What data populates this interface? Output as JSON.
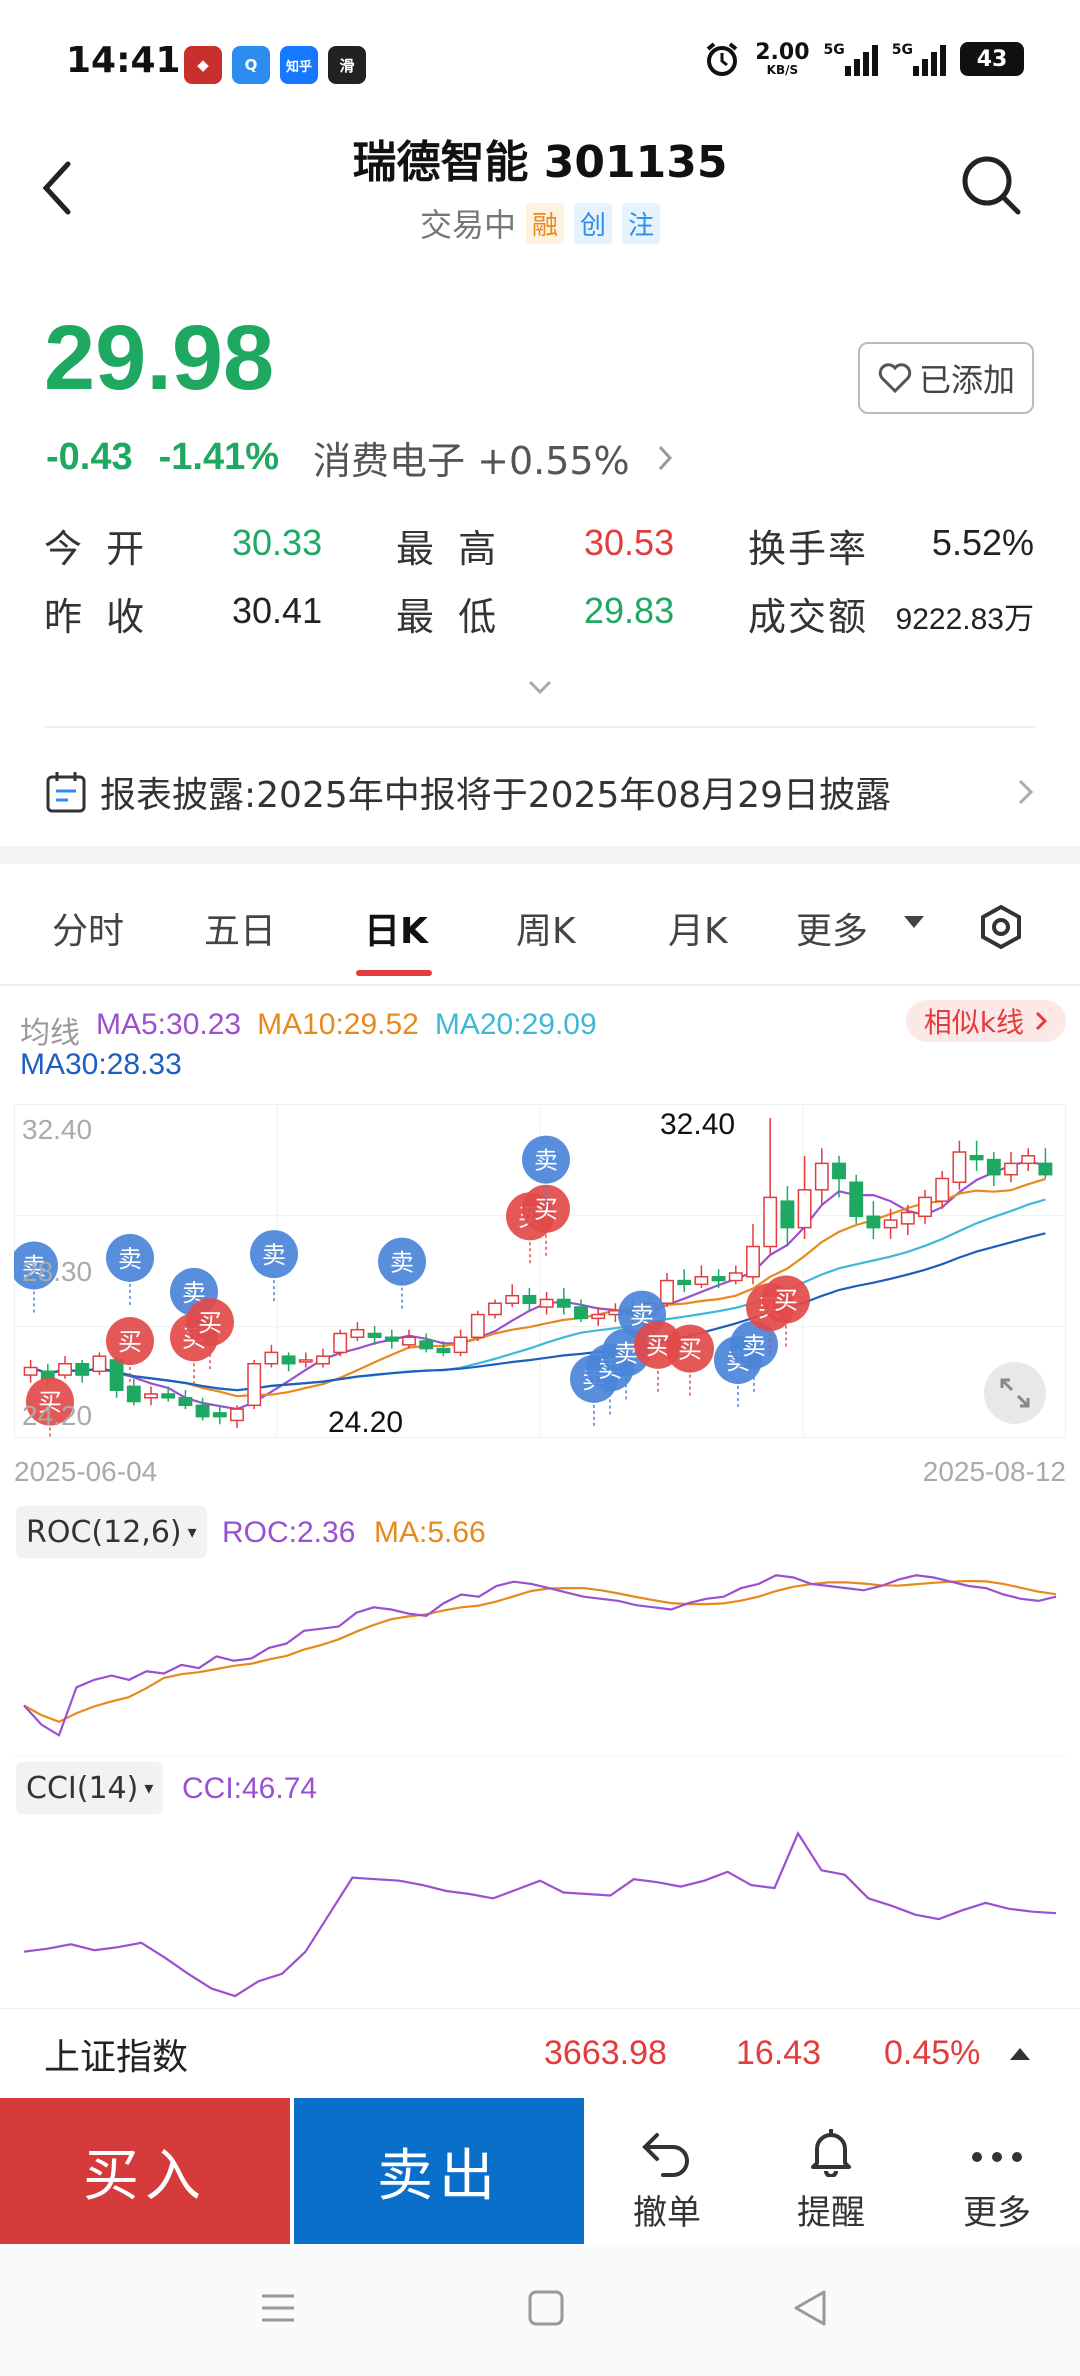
{
  "status_bar": {
    "time": "14:41",
    "apps": [
      {
        "name": "app-icon-1",
        "label": "◆",
        "color": "#c9302c"
      },
      {
        "name": "app-icon-2",
        "label": "Q",
        "color": "#2d8cf0"
      },
      {
        "name": "app-icon-3",
        "label": "知乎",
        "color": "#1677ff"
      },
      {
        "name": "app-icon-4",
        "label": "滑",
        "color": "#222222"
      }
    ],
    "net_speed": "2.00",
    "net_unit": "KB/S",
    "signal1": "5G",
    "signal2": "5G",
    "battery": "43"
  },
  "header": {
    "title": "瑞德智能 301135",
    "trade_status": "交易中",
    "tags": [
      "融",
      "创",
      "注"
    ]
  },
  "quote": {
    "price": "29.98",
    "change": "-0.43",
    "change_pct": "-1.41%",
    "sector": "消费电子 +0.55%",
    "added_label": "已添加",
    "stats": [
      {
        "label": "今 开",
        "value": "30.33",
        "color": "green"
      },
      {
        "label": "最 高",
        "value": "30.53",
        "color": "red"
      },
      {
        "label": "换手率",
        "value": "5.52%",
        "color": "dark"
      },
      {
        "label": "昨 收",
        "value": "30.41",
        "color": "dark"
      },
      {
        "label": "最 低",
        "value": "29.83",
        "color": "green"
      },
      {
        "label": "成交额",
        "value": "9222.83万",
        "color": "dark"
      }
    ]
  },
  "report": {
    "text": "报表披露:2025年中报将于2025年08月29日披露"
  },
  "tabs": {
    "items": [
      "分时",
      "五日",
      "日K",
      "周K",
      "月K",
      "更多"
    ],
    "active": "日K"
  },
  "ma_legend": {
    "label": "均线",
    "ma5": "MA5:30.23",
    "ma10": "MA10:29.52",
    "ma20": "MA20:29.09",
    "ma30": "MA30:28.33",
    "similar": "相似k线"
  },
  "kline": {
    "y_top": "32.40",
    "y_mid": "28.30",
    "y_bottom": "24.20",
    "high_label": "32.40",
    "low_label": "24.20",
    "date_start": "2025-06-04",
    "date_end": "2025-08-12",
    "buy_label": "买",
    "sell_label": "卖"
  },
  "roc": {
    "chip": "ROC(12,6)",
    "value": "ROC:2.36",
    "ma": "MA:5.66"
  },
  "cci": {
    "chip": "CCI(14)",
    "value": "CCI:46.74"
  },
  "index_bar": {
    "name": "上证指数",
    "value": "3663.98",
    "change": "16.43",
    "change_pct": "0.45%"
  },
  "bottom": {
    "buy": "买入",
    "sell": "卖出",
    "cancel": "撤单",
    "remind": "提醒",
    "more": "更多"
  },
  "colors": {
    "up": "#e23c3c",
    "down": "#1ea862",
    "ma5": "#9b4fd1",
    "ma10": "#e8891c",
    "ma20": "#3fb8d8",
    "ma30": "#1d5fbf"
  }
}
